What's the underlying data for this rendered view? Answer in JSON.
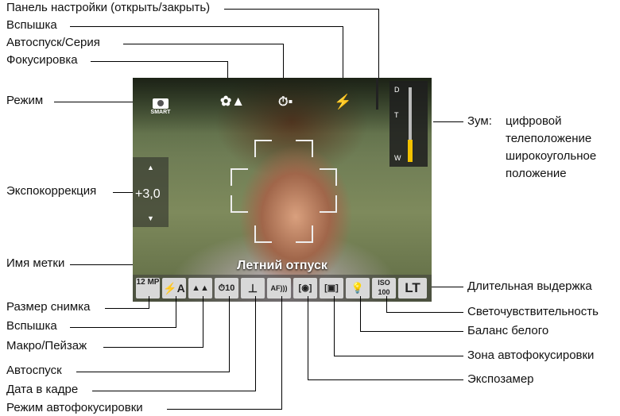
{
  "labels": {
    "panel": "Панель настройки (открыть/закрыть)",
    "flash_top": "Вспышка",
    "selftimer_top": "Автоспуск/Серия",
    "focus_top": "Фокусировка",
    "mode": "Режим",
    "ev": "Экспокоррекция",
    "tag_name": "Имя метки",
    "zoom_title": "Зум:",
    "zoom_digital": "цифровой",
    "zoom_tele": "телеположение",
    "zoom_wide": "широкоугольное",
    "zoom_wide2": "положение",
    "picture_size": "Размер снимка",
    "flash_bottom": "Вспышка",
    "macro": "Макро/Пейзаж",
    "selftimer": "Автоспуск",
    "date_stamp": "Дата в кадре",
    "af_mode": "Режим автофокусировки",
    "long_exposure": "Длительная выдержка",
    "iso": "Светочувствительность",
    "wb": "Баланс белого",
    "af_zone": "Зона автофокусировки",
    "metering": "Экспозамер"
  },
  "screen": {
    "mode_text": "SMART",
    "ev_value": "+3,0",
    "tag_text": "Летний отпуск",
    "zoom": {
      "d": "D",
      "t": "T",
      "w": "W",
      "level": 0.3
    },
    "strip": {
      "size": "12 MP",
      "flash": "⚡A",
      "macro": "▲▲",
      "selftimer": "⏱10",
      "date": "⊥",
      "af": "AF)))",
      "metering": "[◉]",
      "afzone": "[▣]",
      "wb": "💡",
      "iso": "ISO 100",
      "lt": "LT"
    }
  }
}
